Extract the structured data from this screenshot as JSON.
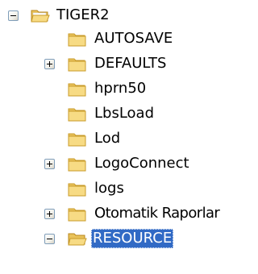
{
  "tree": {
    "root": {
      "label": "TIGER2",
      "state": "expanded",
      "icon": "open-folder-icon"
    },
    "children": [
      {
        "label": "AUTOSAVE",
        "expander": "none",
        "icon": "folder-icon",
        "selected": false
      },
      {
        "label": "DEFAULTS",
        "expander": "plus",
        "icon": "folder-icon",
        "selected": false
      },
      {
        "label": "hprn50",
        "expander": "none",
        "icon": "folder-icon",
        "selected": false
      },
      {
        "label": "LbsLoad",
        "expander": "none",
        "icon": "folder-icon",
        "selected": false
      },
      {
        "label": "Lod",
        "expander": "none",
        "icon": "folder-icon",
        "selected": false
      },
      {
        "label": "LogoConnect",
        "expander": "plus",
        "icon": "folder-icon",
        "selected": false
      },
      {
        "label": "logs",
        "expander": "none",
        "icon": "folder-icon",
        "selected": false
      },
      {
        "label": "Otomatik Raporlar",
        "expander": "plus",
        "icon": "folder-icon",
        "selected": false
      },
      {
        "label": "RESOURCE",
        "expander": "minus",
        "icon": "open-folder-icon",
        "selected": true
      }
    ]
  },
  "colors": {
    "selection_bg": "#316ac5",
    "selection_text": "#ffffff",
    "folder_fill": "#f5d77a",
    "folder_edge": "#c89b2a",
    "expander_border": "#7f9db9"
  }
}
